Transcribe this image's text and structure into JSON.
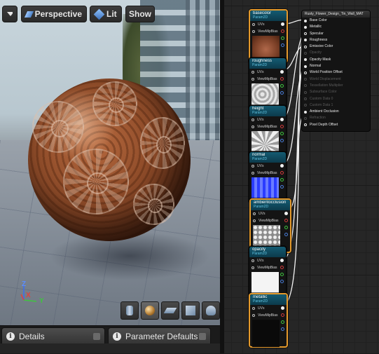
{
  "viewport_toolbar": {
    "menu_icon": "chevron-down-icon",
    "perspective_label": "Perspective",
    "lit_label": "Lit",
    "show_label": "Show"
  },
  "axes": {
    "x": "X",
    "y": "Y",
    "z": "Z"
  },
  "preview_shapes": [
    "cylinder-icon",
    "sphere-icon",
    "plane-icon",
    "cube-icon",
    "teapot-icon"
  ],
  "tabs": {
    "details_label": "Details",
    "parameter_defaults_label": "Parameter Defaults"
  },
  "graph": {
    "texture_nodes": [
      {
        "title": "basecolor",
        "subtitle": "Param2D",
        "pin_uvs": "UVs",
        "pin_mip": "ViewMipBias"
      },
      {
        "title": "roughness",
        "subtitle": "Param2D",
        "pin_uvs": "UVs",
        "pin_mip": "ViewMipBias"
      },
      {
        "title": "height",
        "subtitle": "Param2D",
        "pin_uvs": "UVs",
        "pin_mip": "ViewMipBias"
      },
      {
        "title": "normal",
        "subtitle": "Param2D",
        "pin_uvs": "UVs",
        "pin_mip": "ViewMipBias"
      },
      {
        "title": "ambientocclusion",
        "subtitle": "Param2D",
        "pin_uvs": "UVs",
        "pin_mip": "ViewMipBias"
      },
      {
        "title": "opacity",
        "subtitle": "Param2D",
        "pin_uvs": "UVs",
        "pin_mip": "ViewMipBias"
      },
      {
        "title": "metallic",
        "subtitle": "Param2D",
        "pin_uvs": "UVs",
        "pin_mip": "ViewMipBias"
      }
    ],
    "material_node": {
      "title": "Rusty_Flower_Design_Tin_Wall_MAT",
      "inputs": [
        {
          "label": "Base Color",
          "state": "active"
        },
        {
          "label": "Metallic",
          "state": "active"
        },
        {
          "label": "Specular",
          "state": "hollow"
        },
        {
          "label": "Roughness",
          "state": "active"
        },
        {
          "label": "Emissive Color",
          "state": "hollow"
        },
        {
          "label": "Opacity",
          "state": "dim"
        },
        {
          "label": "Opacity Mask",
          "state": "active"
        },
        {
          "label": "Normal",
          "state": "active"
        },
        {
          "label": "World Position Offset",
          "state": "hollow"
        },
        {
          "label": "World Displacement",
          "state": "dim"
        },
        {
          "label": "Tessellation Multiplier",
          "state": "dim"
        },
        {
          "label": "Subsurface Color",
          "state": "dim"
        },
        {
          "label": "Custom Data 0",
          "state": "dim"
        },
        {
          "label": "Custom Data 1",
          "state": "dim"
        },
        {
          "label": "Ambient Occlusion",
          "state": "active"
        },
        {
          "label": "Refraction",
          "state": "dim"
        },
        {
          "label": "Pixel Depth Offset",
          "state": "hollow"
        }
      ]
    }
  },
  "colors": {
    "node_header": "#145b72",
    "selected_outline": "#e59a2c",
    "pin_red": "#d23b3b",
    "pin_green": "#3fc43f",
    "pin_blue": "#4a7dd8",
    "pin_white": "#f0f0f0"
  }
}
